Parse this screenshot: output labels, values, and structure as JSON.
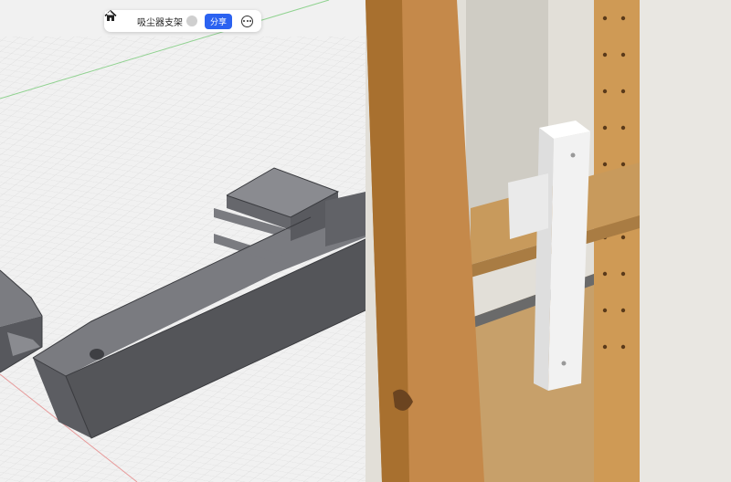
{
  "toolbar": {
    "title": "吸尘器支架",
    "share_label": "分享",
    "icons": {
      "home": "home-icon",
      "dropdown": "chevron-down-icon",
      "more": "more-icon"
    },
    "share_color": "#2b62f0"
  },
  "viewport": {
    "model_color": "#6e6f74",
    "grid_color": "#d6d6d6",
    "axis_x_color": "#e08080",
    "axis_y_color": "#7fcf7f"
  }
}
